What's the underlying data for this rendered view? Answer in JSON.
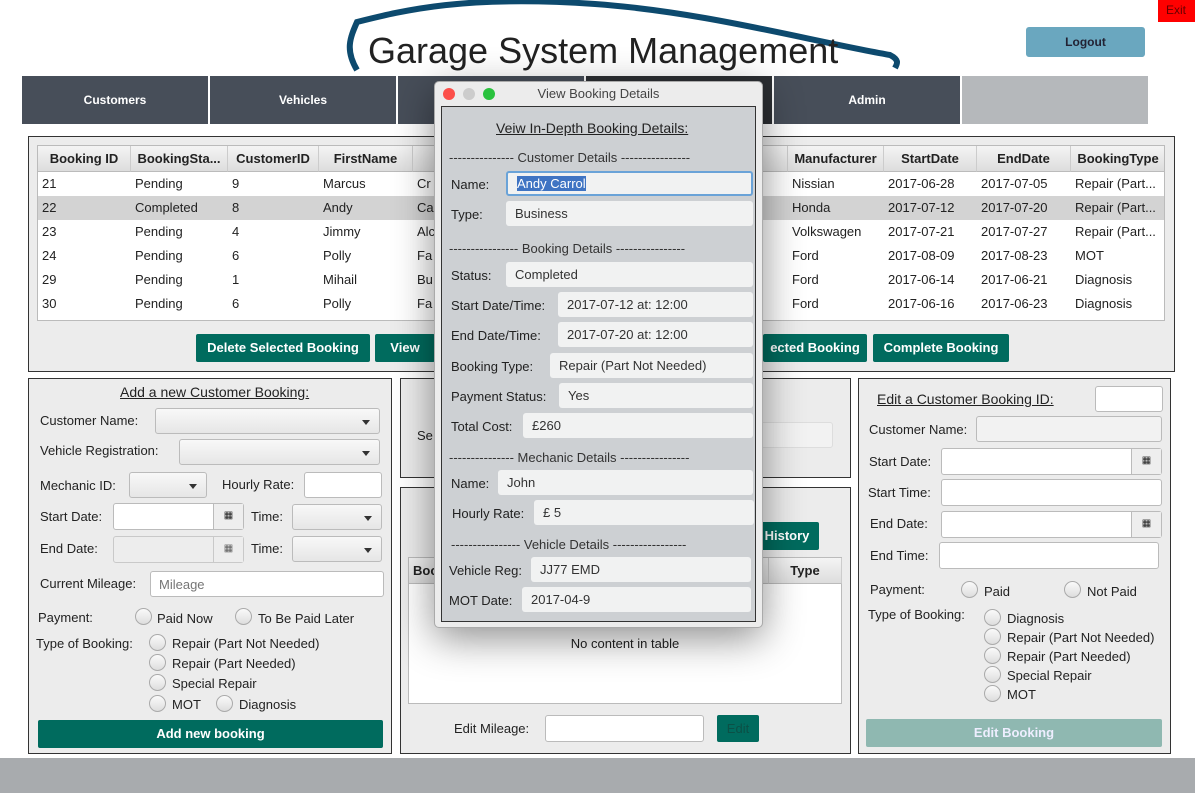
{
  "app": {
    "title": "Garage System Management",
    "exit": "Exit",
    "logout": "Logout"
  },
  "tabs": [
    {
      "label": "Customers"
    },
    {
      "label": "Vehicles"
    },
    {
      "label": ""
    },
    {
      "label": ""
    },
    {
      "label": "Admin"
    },
    {
      "label": ""
    }
  ],
  "bookings": {
    "columns": [
      "Booking ID",
      "BookingSta...",
      "CustomerID",
      "FirstName",
      "L",
      "ype",
      "Manufacturer",
      "StartDate",
      "EndDate",
      "BookingType"
    ],
    "rows": [
      [
        "21",
        "Pending",
        "9",
        "Marcus",
        "Cr",
        "",
        "Nissian",
        "2017-06-28",
        "2017-07-05",
        "Repair (Part..."
      ],
      [
        "22",
        "Completed",
        "8",
        "Andy",
        "Ca",
        "",
        "Honda",
        "2017-07-12",
        "2017-07-20",
        "Repair (Part..."
      ],
      [
        "23",
        "Pending",
        "4",
        "Jimmy",
        "Alc",
        "",
        "Volkswagen",
        "2017-07-21",
        "2017-07-27",
        "Repair (Part..."
      ],
      [
        "24",
        "Pending",
        "6",
        "Polly",
        "Fa",
        "",
        "Ford",
        "2017-08-09",
        "2017-08-23",
        "MOT"
      ],
      [
        "29",
        "Pending",
        "1",
        "Mihail",
        "Bu",
        "",
        "Ford",
        "2017-06-14",
        "2017-06-21",
        "Diagnosis"
      ],
      [
        "30",
        "Pending",
        "6",
        "Polly",
        "Fa",
        "",
        "Ford",
        "2017-06-16",
        "2017-06-23",
        "Diagnosis"
      ]
    ],
    "selected_row": 1,
    "delete_btn": "Delete Selected Booking",
    "view_btn": "View",
    "edit_selected_btn": "ected Booking",
    "complete_btn": "Complete Booking"
  },
  "add": {
    "title": "Add a new Customer Booking:",
    "customer_name": "Customer Name:",
    "vehicle_reg": "Vehicle Registration:",
    "mechanic_id": "Mechanic ID:",
    "hourly_rate": "Hourly Rate:",
    "start_date": "Start Date:",
    "time": "Time:",
    "end_date": "End Date:",
    "mileage": "Current Mileage:",
    "mileage_placeholder": "Mileage",
    "payment": "Payment:",
    "paid_now": "Paid Now",
    "paid_later": "To Be Paid Later",
    "type": "Type of Booking:",
    "types": [
      "Repair (Part Not Needed)",
      "Repair (Part Needed)",
      "Special Repair",
      "MOT",
      "Diagnosis"
    ],
    "submit": "Add new booking"
  },
  "middle": {
    "search_label": "Se",
    "history_btn": "History",
    "table_col_first": "Boo",
    "table_col_type": "Type",
    "empty": "No content in table",
    "edit_mileage": "Edit Mileage:",
    "edit_btn": "Edit"
  },
  "edit": {
    "title": "Edit a Customer Booking ID:",
    "customer_name": "Customer Name:",
    "start_date": "Start Date:",
    "start_time": "Start Time:",
    "end_date": "End Date:",
    "end_time": "End Time:",
    "payment": "Payment:",
    "paid": "Paid",
    "not_paid": "Not Paid",
    "type": "Type of Booking:",
    "types": [
      "Diagnosis",
      "Repair (Part Not Needed)",
      "Repair (Part Needed)",
      "Special Repair",
      "MOT"
    ],
    "submit": "Edit Booking"
  },
  "dialog": {
    "title": "View Booking Details",
    "heading": "Veiw In-Depth Booking Details:",
    "customer_section": "--------------- Customer Details ----------------",
    "name_label": "Name:",
    "name": "Andy Carrol",
    "type_label": "Type:",
    "type": "Business",
    "booking_section": "---------------- Booking Details ----------------",
    "status_label": "Status:",
    "status": "Completed",
    "start_label": "Start Date/Time:",
    "start": "2017-07-12 at: 12:00",
    "end_label": "End Date/Time:",
    "end": "2017-07-20 at: 12:00",
    "btype_label": "Booking Type:",
    "btype": "Repair (Part Not Needed)",
    "payment_label": "Payment Status:",
    "payment": "Yes",
    "cost_label": "Total Cost:",
    "cost": "£260",
    "mechanic_section": "--------------- Mechanic Details ----------------",
    "mname_label": "Name:",
    "mname": "John",
    "rate_label": "Hourly Rate:",
    "rate": "£ 5",
    "vehicle_section": "---------------- Vehicle Details -----------------",
    "reg_label": "Vehicle Reg:",
    "reg": "JJ77 EMD",
    "mot_label": "MOT Date:",
    "mot": "2017-04-9"
  },
  "colors": {
    "accent": "#006b5e",
    "tab": "#474e59",
    "logout": "#6aa7bf",
    "exit": "#ff0000",
    "logo": "#0d4a6e"
  }
}
